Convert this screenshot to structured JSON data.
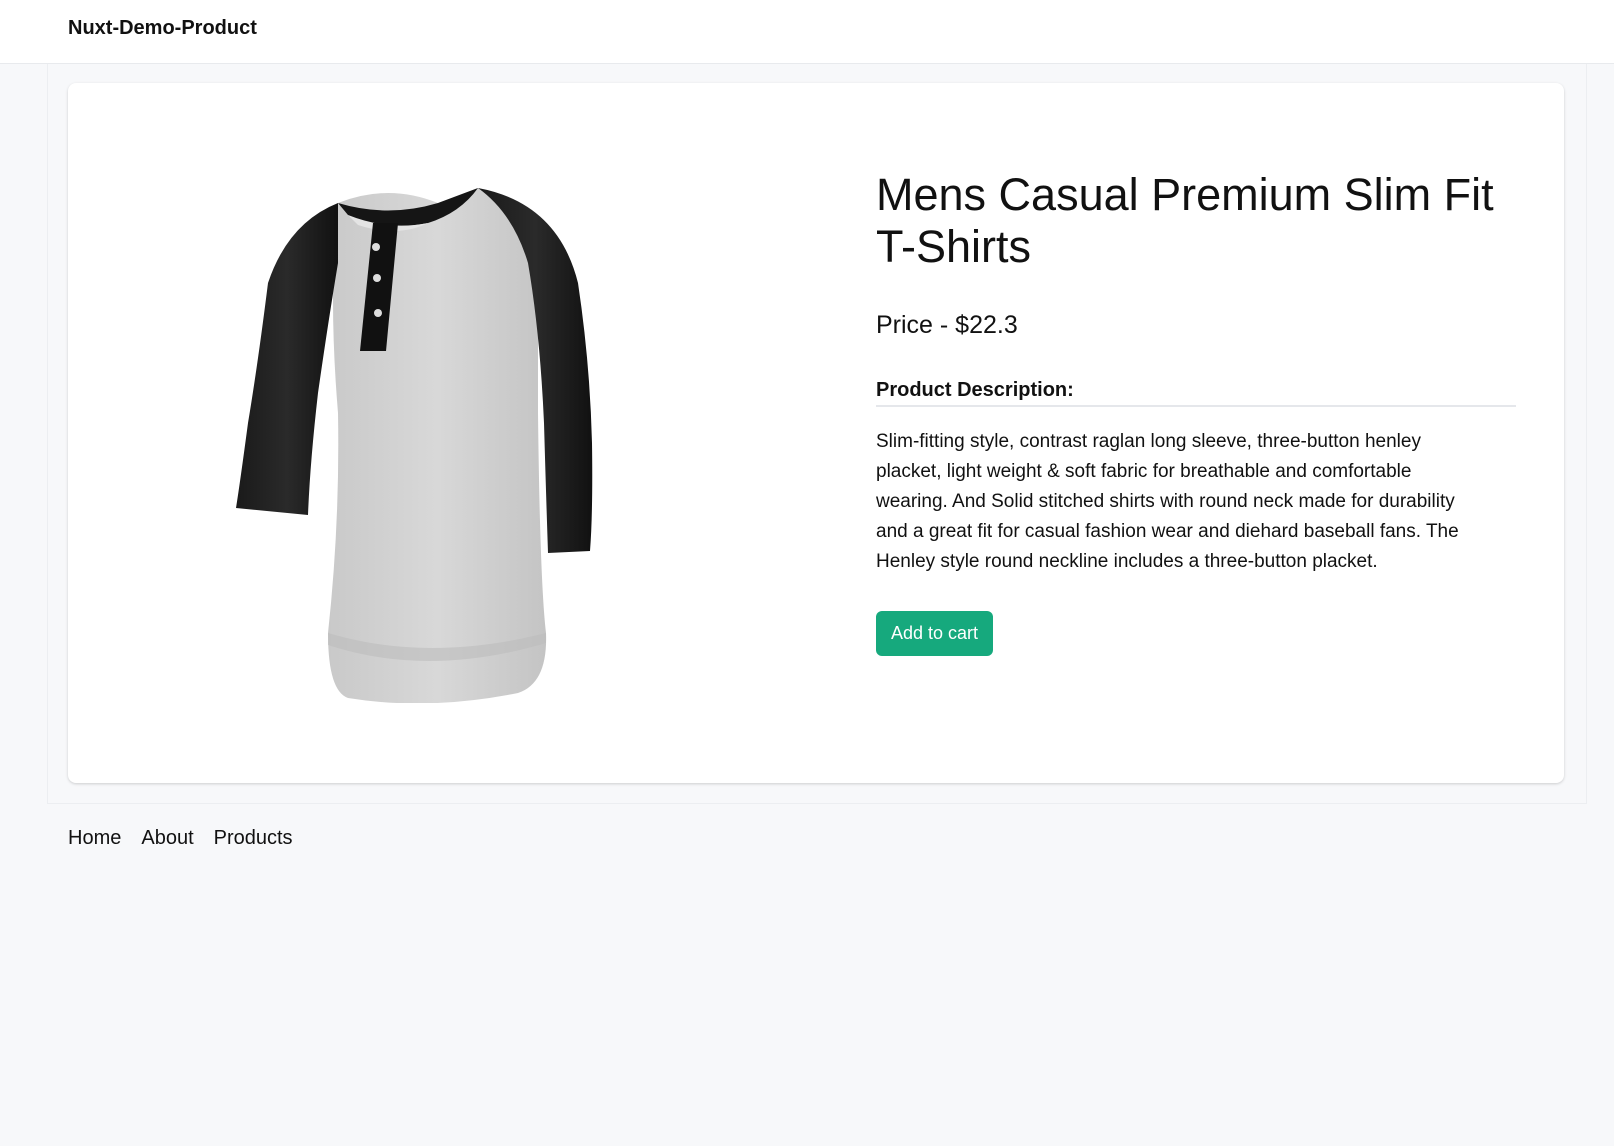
{
  "header": {
    "brand": "Nuxt-Demo-Product"
  },
  "product": {
    "image_icon": "shirt-image",
    "title": "Mens Casual Premium Slim Fit T-Shirts",
    "price_text": "Price - $22.3",
    "description_heading": "Product Description:",
    "description": "Slim-fitting style, contrast raglan long sleeve, three-button henley placket, light weight & soft fabric for breathable and comfortable wearing. And Solid stitched shirts with round neck made for durability and a great fit for casual fashion wear and diehard baseball fans. The Henley style round neckline includes a three-button placket.",
    "add_to_cart_label": "Add to cart",
    "accent_color": "#16a97d"
  },
  "footer": {
    "links": [
      {
        "label": "Home"
      },
      {
        "label": "About"
      },
      {
        "label": "Products"
      }
    ]
  }
}
